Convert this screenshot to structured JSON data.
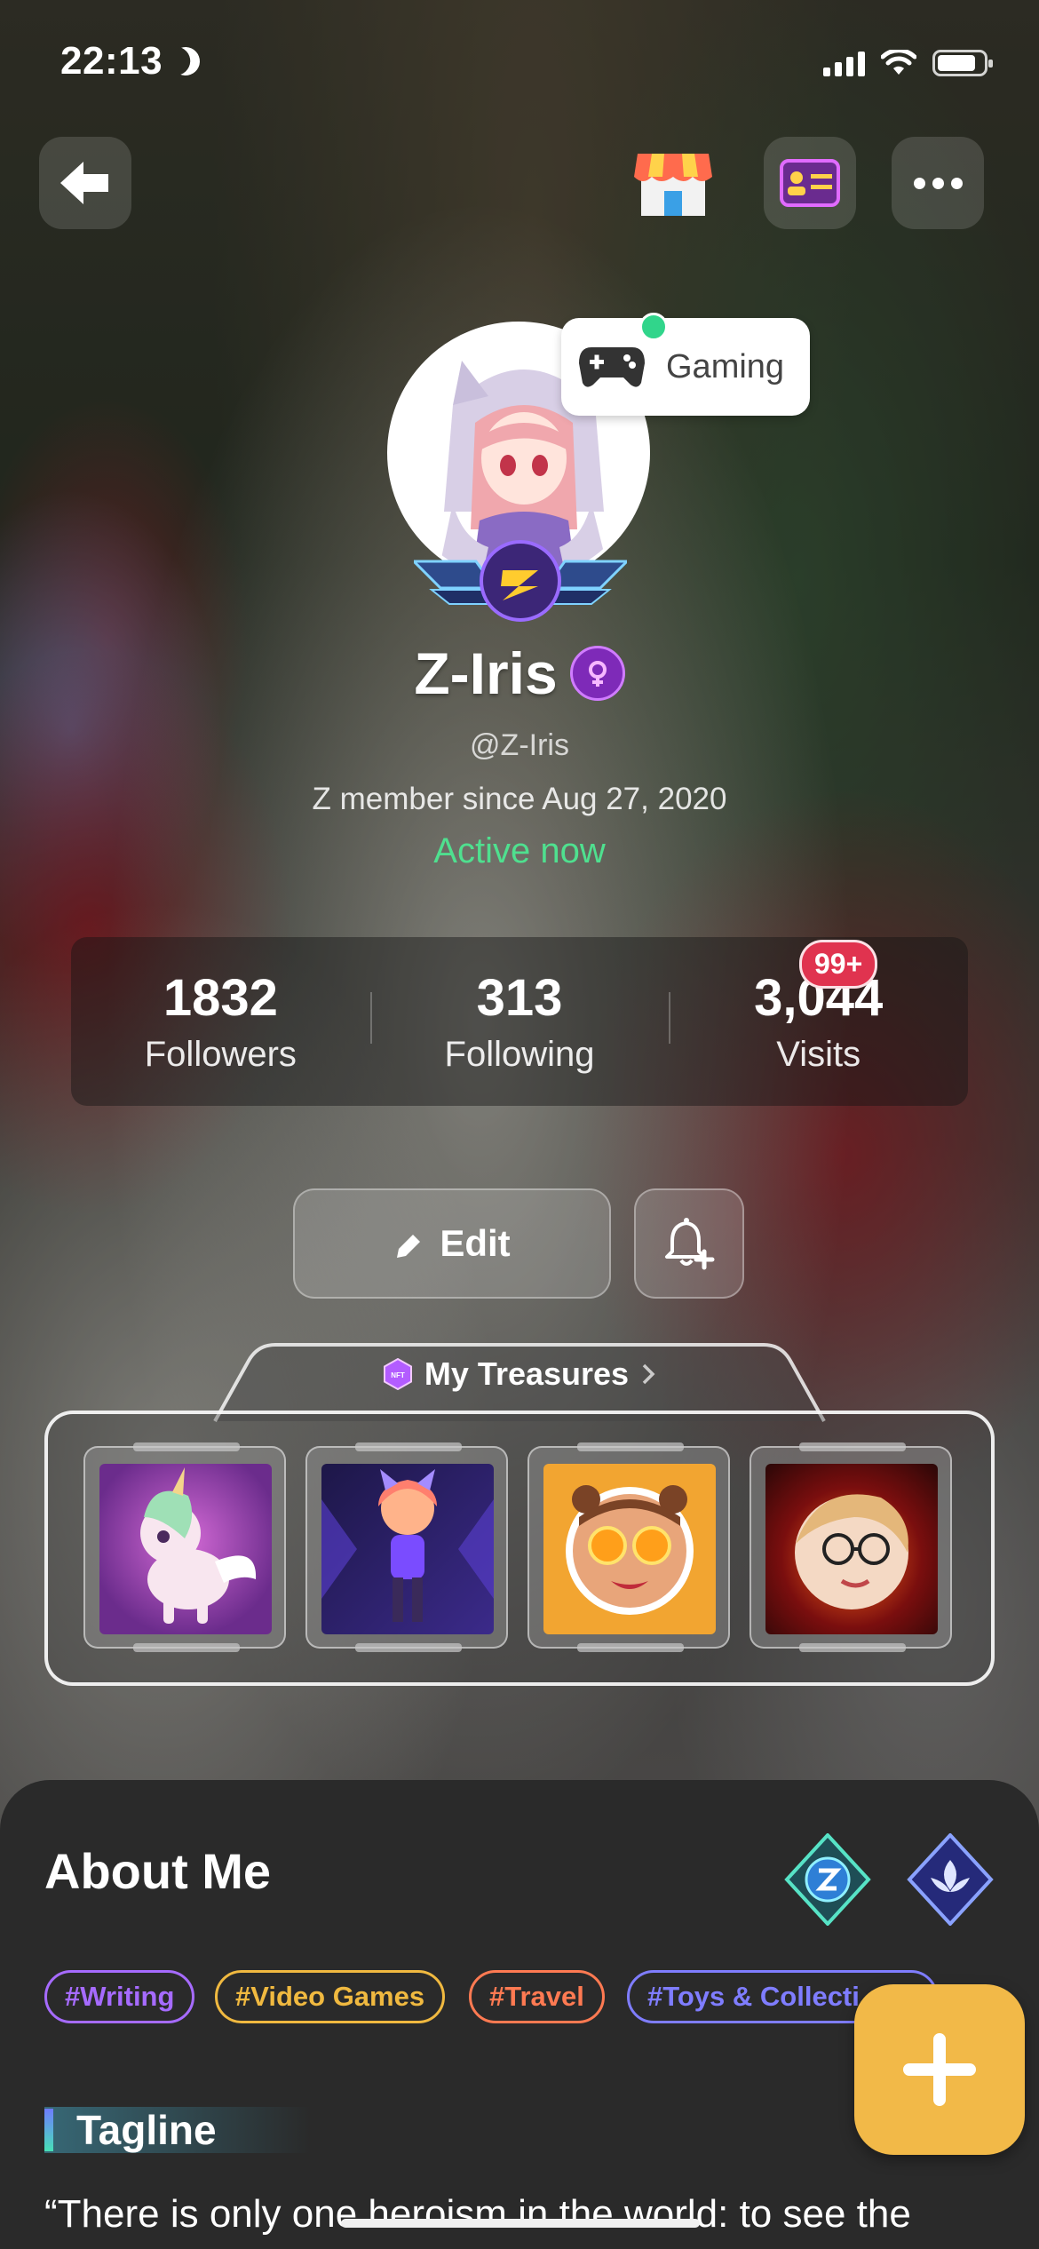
{
  "status_bar": {
    "time": "22:13"
  },
  "profile": {
    "status": "Gaming",
    "name": "Z-Iris",
    "handle": "@Z-Iris",
    "member_since": "Z member since Aug 27, 2020",
    "presence": "Active now"
  },
  "stats": [
    {
      "value": "1832",
      "label": "Followers"
    },
    {
      "value": "313",
      "label": "Following"
    },
    {
      "value": "3,044",
      "label": "Visits"
    }
  ],
  "visits_badge": "99+",
  "actions": {
    "edit_label": "Edit"
  },
  "treasures": {
    "title": "My Treasures",
    "badge_text": "NFT",
    "items": [
      "unicorn",
      "cat-girl",
      "orange-eyes",
      "fire-glasses"
    ]
  },
  "about": {
    "title": "About Me",
    "tags": [
      "#Writing",
      "#Video Games",
      "#Travel",
      "#Toys & Collecti"
    ],
    "tagline_title": "Tagline",
    "quote": "“There is only one heroism in the world: to see the"
  },
  "colors": {
    "active": "#4fe08f",
    "visits_badge": "#e0334f",
    "fab": "#f2b948",
    "tag_writing": "#a66bff",
    "tag_video_games": "#f0b940",
    "tag_travel": "#ff7a52",
    "tag_toys": "#7f7dff"
  }
}
